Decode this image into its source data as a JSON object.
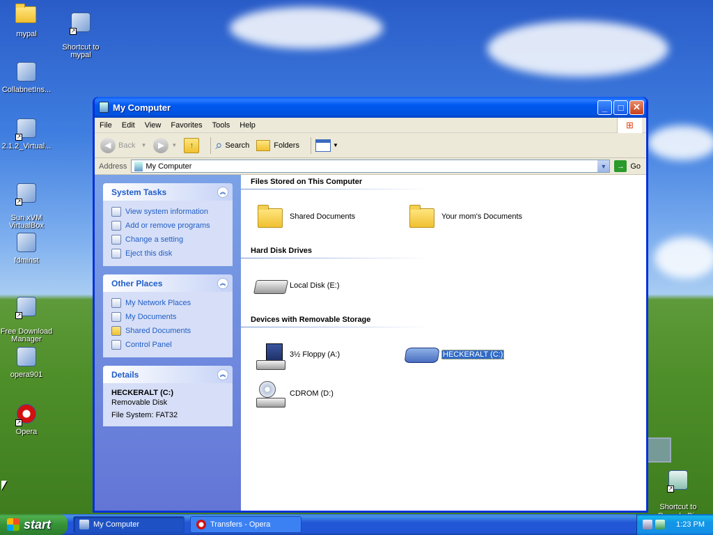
{
  "desktop": {
    "icons": [
      {
        "label": "mypal",
        "icon": "folder-icon"
      },
      {
        "label": "Shortcut to\nmypal",
        "icon": "raccoon-icon"
      },
      {
        "label": "CollabnetIns...",
        "icon": "installer-icon"
      },
      {
        "label": "2.1.2_Virtual...",
        "icon": "installer-icon"
      },
      {
        "label": "Sun xVM\nVirtualBox",
        "icon": "virtualbox-icon"
      },
      {
        "label": "fdminst",
        "icon": "installer-icon"
      },
      {
        "label": "Free Download\nManager",
        "icon": "download-manager-icon"
      },
      {
        "label": "opera901",
        "icon": "installer-icon"
      },
      {
        "label": "Opera",
        "icon": "opera-icon"
      },
      {
        "label": "Shortcut to\nRecycle Bin",
        "icon": "recycle-bin-icon"
      }
    ]
  },
  "window": {
    "title": "My Computer",
    "menu": [
      "File",
      "Edit",
      "View",
      "Favorites",
      "Tools",
      "Help"
    ],
    "toolbar": {
      "back": "Back",
      "search": "Search",
      "folders": "Folders"
    },
    "address": {
      "label": "Address",
      "value": "My Computer",
      "go": "Go"
    },
    "left_pane": {
      "system_tasks": {
        "title": "System Tasks",
        "items": [
          "View system information",
          "Add or remove programs",
          "Change a setting",
          "Eject this disk"
        ]
      },
      "other_places": {
        "title": "Other Places",
        "items": [
          "My Network Places",
          "My Documents",
          "Shared Documents",
          "Control Panel"
        ]
      },
      "details": {
        "title": "Details",
        "name": "HECKERALT (C:)",
        "type": "Removable Disk",
        "filesystem": "File System: FAT32"
      }
    },
    "groups": {
      "files_stored": {
        "title": "Files Stored on This Computer",
        "items": [
          "Shared Documents",
          "Your mom's Documents"
        ]
      },
      "hard_disks": {
        "title": "Hard Disk Drives",
        "items": [
          "Local Disk (E:)"
        ]
      },
      "removable": {
        "title": "Devices with Removable Storage",
        "items": [
          "3½ Floppy (A:)",
          "HECKERALT (C:)",
          "CDROM (D:)"
        ]
      }
    }
  },
  "taskbar": {
    "start": "start",
    "tasks": [
      "My Computer",
      "Transfers - Opera"
    ],
    "clock": "1:23 PM"
  },
  "colors": {
    "title_blue": "#0054e3",
    "link_blue": "#215dc6",
    "selection": "#316ac5",
    "start_green": "#3c8f3c"
  }
}
